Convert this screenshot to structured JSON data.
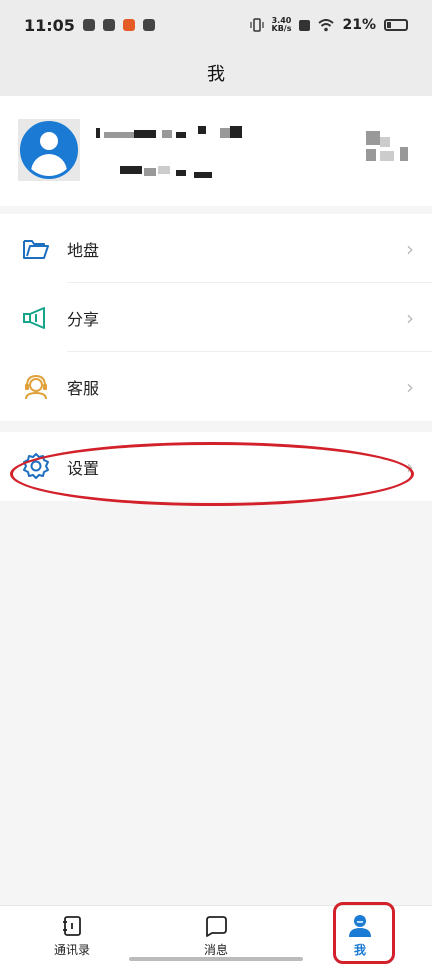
{
  "status_bar": {
    "time": "11:05",
    "net_speed_value": "3.40",
    "net_speed_unit": "KB/s",
    "battery": "21%"
  },
  "header": {
    "title": "我"
  },
  "menu": {
    "group1": [
      {
        "label": "地盘",
        "icon": "folder-icon"
      },
      {
        "label": "分享",
        "icon": "megaphone-icon"
      },
      {
        "label": "客服",
        "icon": "headset-icon"
      }
    ],
    "group2": [
      {
        "label": "设置",
        "icon": "gear-icon"
      }
    ]
  },
  "bottom_nav": {
    "items": [
      {
        "label": "通讯录",
        "icon": "contacts-icon"
      },
      {
        "label": "消息",
        "icon": "message-icon"
      },
      {
        "label": "我",
        "icon": "person-icon"
      }
    ]
  },
  "colors": {
    "accent": "#1a7ad4",
    "highlight": "#d2212a",
    "folder": "#1f6fc0",
    "megaphone": "#14a58a",
    "headset": "#e0a23a"
  }
}
